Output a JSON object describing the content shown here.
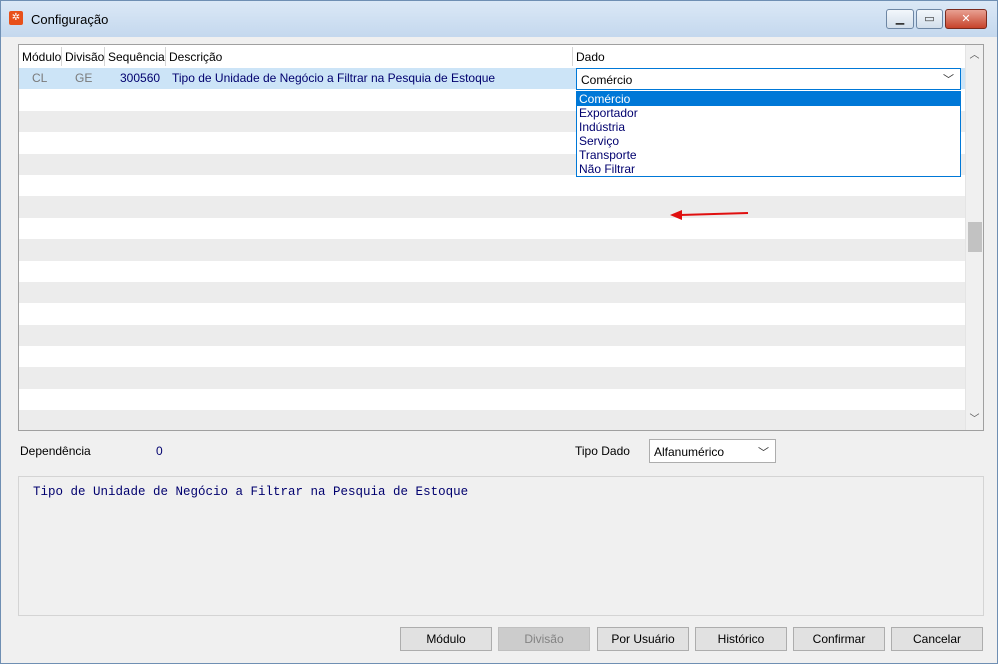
{
  "window": {
    "title": "Configuração",
    "minimize": "▁",
    "maximize": "▭",
    "close": "✕"
  },
  "grid": {
    "columns": [
      "Módulo",
      "Divisão",
      "Sequência",
      "Descrição",
      "Dado"
    ],
    "rows": [
      {
        "modulo": "CL",
        "divisao": "GE",
        "sequencia": "300560",
        "descricao": "Tipo de Unidade de Negócio a Filtrar na Pesquia de Estoque",
        "dado": "Comércio"
      }
    ]
  },
  "dropdown": {
    "options": [
      "Comércio",
      "Exportador",
      "Indústria",
      "Serviço",
      "Transporte",
      "Não Filtrar"
    ],
    "selected": "Comércio"
  },
  "annotation_color": "#e01010",
  "details": {
    "dependencia_label": "Dependência",
    "dependencia_value": "0",
    "tipo_dado_label": "Tipo Dado",
    "tipo_dado_value": "Alfanumérico"
  },
  "memo": "Tipo de Unidade de Negócio a Filtrar na Pesquia de Estoque",
  "buttons": {
    "modulo": "Módulo",
    "divisao": "Divisão",
    "por_usuario": "Por Usuário",
    "historico": "Histórico",
    "confirmar": "Confirmar",
    "cancelar": "Cancelar"
  }
}
